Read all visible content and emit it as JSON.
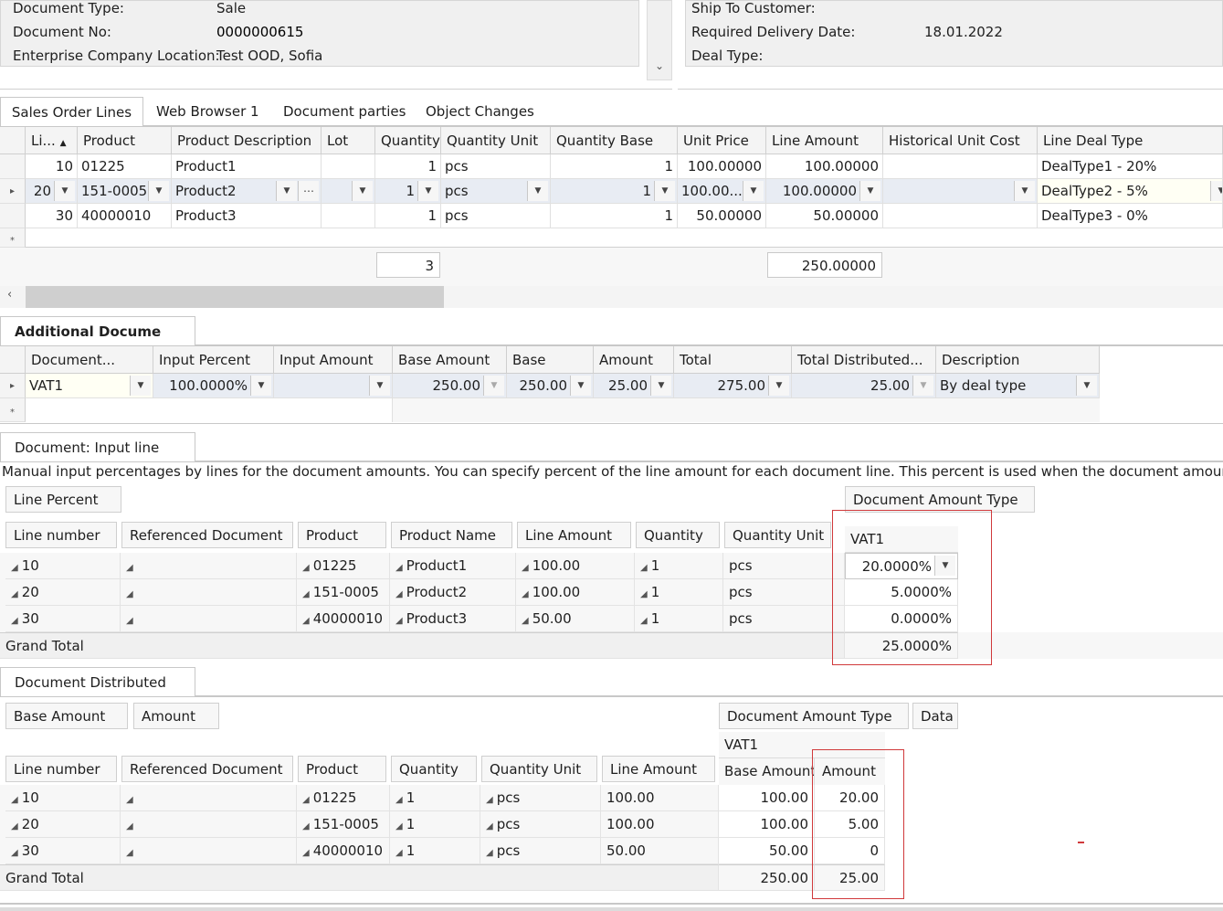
{
  "header_left": {
    "rows": [
      {
        "label": "Document Type:",
        "value": "Sale"
      },
      {
        "label": "Document No:",
        "value": "0000000615"
      },
      {
        "label": "Enterprise Company Location:",
        "value": "Test OOD, Sofia"
      }
    ]
  },
  "header_right": {
    "rows": [
      {
        "label": "Ship To Customer:",
        "value": ""
      },
      {
        "label": "Required Delivery Date:",
        "value": "18.01.2022"
      },
      {
        "label": "Deal Type:",
        "value": ""
      }
    ]
  },
  "tabs": [
    "Sales Order Lines",
    "Web Browser 1",
    "Document parties",
    "Object Changes"
  ],
  "lines_grid": {
    "columns": [
      "Li...",
      "Product",
      "Product Description",
      "Lot",
      "Quantity",
      "Quantity Unit",
      "Quantity Base",
      "Unit Price",
      "Line Amount",
      "Historical Unit Cost",
      "Line Deal Type"
    ],
    "rows": [
      [
        "10",
        "01225",
        "Product1",
        "",
        "1",
        "pcs",
        "1",
        "100.00000",
        "100.00000",
        "",
        "DealType1 - 20%"
      ],
      [
        "20",
        "151-0005",
        "Product2",
        "",
        "1",
        "pcs",
        "1",
        "100.00...",
        "100.00000",
        "",
        "DealType2 - 5%"
      ],
      [
        "30",
        "40000010",
        "Product3",
        "",
        "1",
        "pcs",
        "1",
        "50.00000",
        "50.00000",
        "",
        "DealType3 - 0%"
      ]
    ],
    "totals": {
      "quantity": "3",
      "line_amount": "250.00000"
    }
  },
  "additional_tab": "Additional Docume",
  "additional_grid": {
    "columns": [
      "Document...",
      "Input Percent",
      "Input Amount",
      "Base Amount",
      "Base",
      "Amount",
      "Total",
      "Total Distributed...",
      "Description"
    ],
    "row": [
      "VAT1",
      "100.0000%",
      "",
      "250.00",
      "250.00",
      "25.00",
      "275.00",
      "25.00",
      "By deal type"
    ]
  },
  "input_tab": "Document: Input line",
  "input_pivot": {
    "description": "Manual input percentages by lines for the document amounts. You can specify percent of the line amount for each document line. This percent is used when the document amount is distributed",
    "data_field": "Line Percent",
    "column_field": "Document Amount Type",
    "column_value": "VAT1",
    "row_fields": [
      "Line number",
      "Referenced Document",
      "Product",
      "Product Name",
      "Line Amount",
      "Quantity",
      "Quantity Unit"
    ],
    "rows": [
      {
        "cells": [
          "10",
          "",
          "01225",
          "Product1",
          "100.00",
          "1",
          "pcs"
        ],
        "value": "20.0000%"
      },
      {
        "cells": [
          "20",
          "",
          "151-0005",
          "Product2",
          "100.00",
          "1",
          "pcs"
        ],
        "value": "5.0000%"
      },
      {
        "cells": [
          "30",
          "",
          "40000010",
          "Product3",
          "50.00",
          "1",
          "pcs"
        ],
        "value": "0.0000%"
      }
    ],
    "grand_total_label": "Grand Total",
    "grand_total": "25.0000%"
  },
  "distributed_tab": "Document Distributed",
  "distributed_pivot": {
    "data_fields": [
      "Base Amount",
      "Amount"
    ],
    "column_fields": [
      "Document Amount Type",
      "Data"
    ],
    "column_value": "VAT1",
    "value_headers": [
      "Base Amount",
      "Amount"
    ],
    "row_fields": [
      "Line number",
      "Referenced Document",
      "Product",
      "Quantity",
      "Quantity Unit",
      "Line Amount"
    ],
    "rows": [
      {
        "cells": [
          "10",
          "",
          "01225",
          "1",
          "pcs",
          "100.00"
        ],
        "base": "100.00",
        "amount": "20.00"
      },
      {
        "cells": [
          "20",
          "",
          "151-0005",
          "1",
          "pcs",
          "100.00"
        ],
        "base": "100.00",
        "amount": "5.00"
      },
      {
        "cells": [
          "30",
          "",
          "40000010",
          "1",
          "pcs",
          "50.00"
        ],
        "base": "50.00",
        "amount": "0"
      }
    ],
    "grand_total_label": "Grand Total",
    "grand_total_base": "250.00",
    "grand_total_amount": "25.00"
  }
}
